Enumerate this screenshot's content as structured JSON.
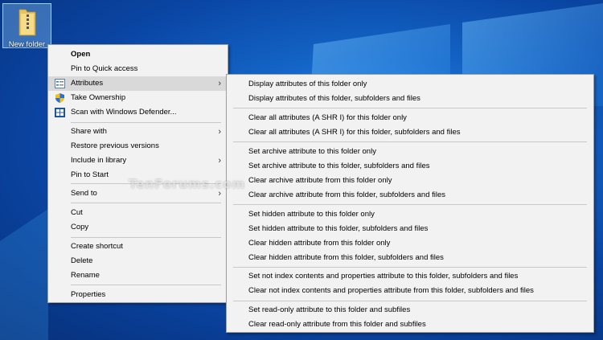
{
  "desktop": {
    "folder_label": "New folder",
    "watermark": "TenForums.com"
  },
  "context_menu": {
    "items": [
      {
        "label": "Open",
        "bold": true
      },
      {
        "label": "Pin to Quick access"
      },
      {
        "label": "Attributes",
        "icon": "attributes-icon",
        "submenu": true,
        "highlighted": true
      },
      {
        "label": "Take Ownership",
        "icon": "shield-icon"
      },
      {
        "label": "Scan with Windows Defender...",
        "icon": "defender-icon"
      },
      {
        "label": "Share with",
        "submenu": true
      },
      {
        "label": "Restore previous versions"
      },
      {
        "label": "Include in library",
        "submenu": true
      },
      {
        "label": "Pin to Start"
      },
      {
        "label": "Send to",
        "submenu": true
      },
      {
        "label": "Cut"
      },
      {
        "label": "Copy"
      },
      {
        "label": "Create shortcut"
      },
      {
        "label": "Delete"
      },
      {
        "label": "Rename"
      },
      {
        "label": "Properties"
      }
    ]
  },
  "submenu": {
    "items": [
      {
        "label": "Display attributes of this folder only"
      },
      {
        "label": "Display attributes of this folder, subfolders and files"
      },
      {
        "label": "Clear all attributes (A SHR I) for this folder only"
      },
      {
        "label": "Clear all attributes (A SHR I) for this folder, subfolders and files"
      },
      {
        "label": "Set archive attribute to this folder only"
      },
      {
        "label": "Set archive attribute to this folder, subfolders and files"
      },
      {
        "label": "Clear archive attribute from this folder only"
      },
      {
        "label": "Clear archive attribute from this folder, subfolders and files"
      },
      {
        "label": "Set hidden attribute to this folder only"
      },
      {
        "label": "Set hidden attribute to this folder, subfolders and files"
      },
      {
        "label": "Clear hidden attribute from this folder only"
      },
      {
        "label": "Clear hidden attribute from this folder, subfolders and files"
      },
      {
        "label": "Set not index contents and properties attribute to this folder, subfolders and files"
      },
      {
        "label": "Clear not index contents and properties attribute from this folder, subfolders and files"
      },
      {
        "label": "Set read-only attribute to this folder and subfiles"
      },
      {
        "label": "Clear read-only attribute from this folder and subfiles"
      }
    ]
  },
  "colors": {
    "desktop_blue": "#1466c8",
    "menu_background": "#f2f2f2",
    "menu_highlight": "#d9d9d9",
    "separator": "#c8c8c8"
  }
}
